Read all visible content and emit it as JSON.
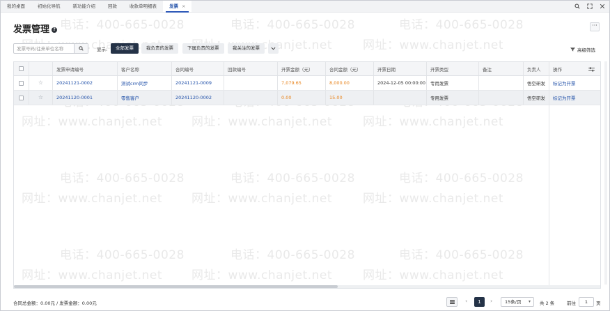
{
  "tabs": [
    {
      "label": "我的桌面",
      "active": false
    },
    {
      "label": "初始化导航",
      "active": false
    },
    {
      "label": "新功能介绍",
      "active": false
    },
    {
      "label": "回款",
      "active": false
    },
    {
      "label": "收款单明细表",
      "active": false
    },
    {
      "label": "发票",
      "active": true,
      "close": "×"
    }
  ],
  "window_tools": [
    "search-icon",
    "restore-icon",
    "close-icon"
  ],
  "page": {
    "title": "发票管理",
    "help": "?",
    "more": "···"
  },
  "filters": {
    "search_placeholder": "发票号码/往来单位名称",
    "show_label": "显示:",
    "segments": [
      "全部发票",
      "我负责的发票",
      "下属负责的发票",
      "我关注的发票"
    ],
    "advanced": "高级筛选"
  },
  "table": {
    "columns": [
      "发票申请编号",
      "客户名称",
      "合同编号",
      "回款编号",
      "开票金额（元）",
      "合同金额（元）",
      "开票日期",
      "开票类型",
      "备注",
      "负责人",
      "操作"
    ],
    "rows": [
      {
        "apply_no": "20241121-0002",
        "customer": "测试crm同步",
        "contract_no": "20241121-0009",
        "payment_no": "",
        "invoice_amount": "7,079.65",
        "contract_amount": "8,000.00",
        "invoice_date": "2024-12-05 00:00:00",
        "invoice_type": "专用发票",
        "note": "",
        "owner": "悟空研发",
        "action": "标记为开票"
      },
      {
        "apply_no": "20241120-0001",
        "customer": "零售客户",
        "contract_no": "20241120-0002",
        "payment_no": "",
        "invoice_amount": "0.00",
        "contract_amount": "15.00",
        "invoice_date": "",
        "invoice_type": "专用发票",
        "note": "",
        "owner": "悟空研发",
        "action": "标记为开票"
      }
    ]
  },
  "footer": {
    "totals": "合同总金额：0.00元 / 发票金额：0.00元",
    "current_page": "1",
    "page_size": "15条/页",
    "total": "共 2 条",
    "goto_label": "前往",
    "goto_value": "1",
    "page_unit": "页"
  },
  "watermark": {
    "phone": "电话：400-665-0028",
    "site": "网址：www.chanjet.net"
  },
  "colors": {
    "primary": "#243247",
    "link": "#1f4fa8",
    "amount": "#e8831b"
  }
}
